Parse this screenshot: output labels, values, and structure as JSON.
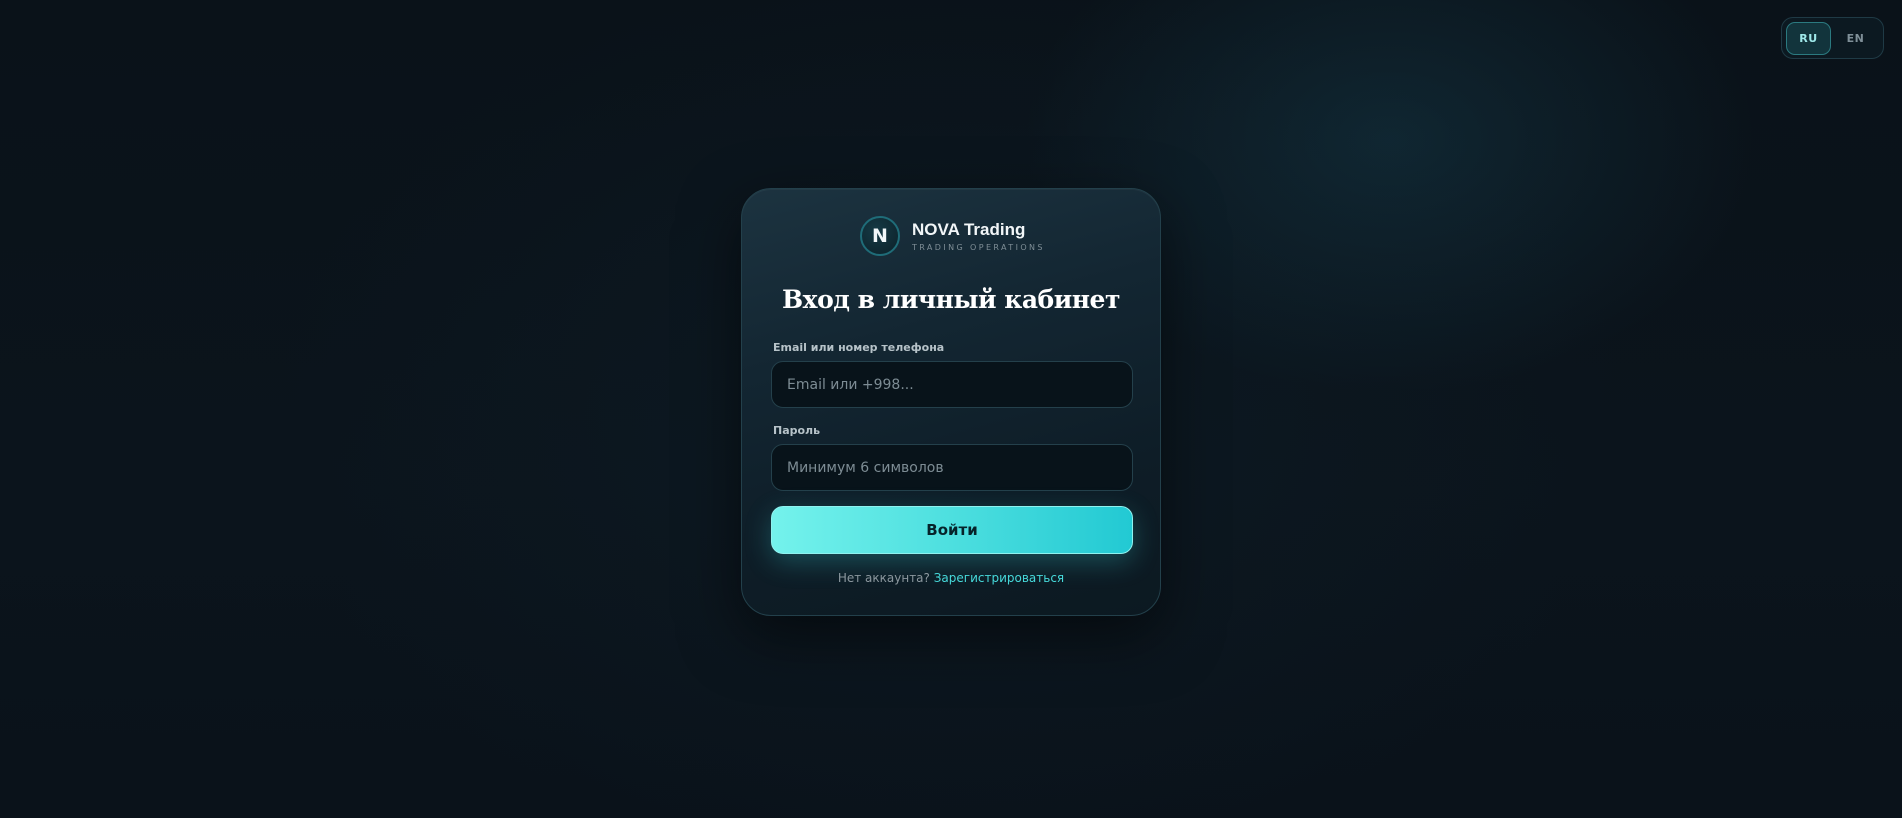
{
  "language_switcher": {
    "options": [
      {
        "label": "RU",
        "active": true
      },
      {
        "label": "EN",
        "active": false
      }
    ]
  },
  "brand": {
    "logo_letter": "N",
    "name": "NOVA Trading",
    "subtitle": "TRADING OPERATIONS"
  },
  "login_form": {
    "title": "Вход в личный кабинет",
    "email_label": "Email или номер телефона",
    "email_placeholder": "Email или +998...",
    "email_value": "",
    "password_label": "Пароль",
    "password_placeholder": "Минимум 6 символов",
    "password_value": "",
    "submit_label": "Войти",
    "footer_text": "Нет аккаунта?",
    "register_link": "Зарегистрироваться"
  },
  "colors": {
    "accent": "#4ddfdf",
    "background": "#0a1219",
    "card": "#132632"
  }
}
